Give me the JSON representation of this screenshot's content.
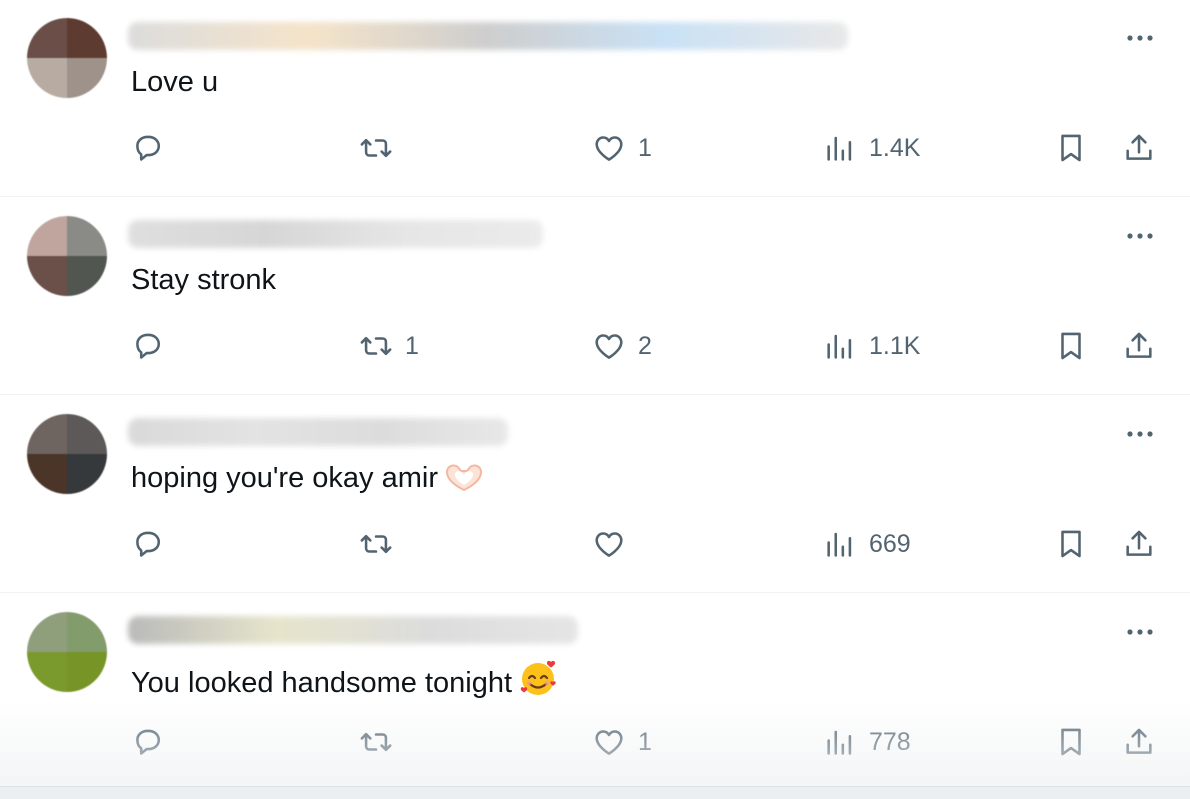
{
  "replies": [
    {
      "text": "Love u",
      "emoji": "",
      "avatar_colors": [
        "#6b4e48",
        "#5e3b30",
        "#b7aba2",
        "#9f928a"
      ],
      "name_blur_colors": [
        "#d9d9d9",
        "#f4e1c4",
        "#c9c9c9",
        "#c4dff5",
        "#e6e6e6"
      ],
      "name_blur_width": 720,
      "reply_count": "",
      "retweet_count": "",
      "like_count": "1",
      "views_count": "1.4K"
    },
    {
      "text": "Stay stronk",
      "emoji": "",
      "avatar_colors": [
        "#c0a59f",
        "#8a8a86",
        "#6a5048",
        "#525650"
      ],
      "name_blur_colors": [
        "#dcdcdc",
        "#d2d2d2",
        "#e4e4e4",
        "#e9e9e9"
      ],
      "name_blur_width": 415,
      "reply_count": "",
      "retweet_count": "1",
      "like_count": "2",
      "views_count": "1.1K"
    },
    {
      "text": "hoping you're okay amir",
      "emoji": "heart-hands",
      "avatar_colors": [
        "#6e6460",
        "#5d5958",
        "#4b3428",
        "#35393b"
      ],
      "name_blur_colors": [
        "#d6d6d6",
        "#e0e0e0",
        "#d9d9d9",
        "#e6e6e6"
      ],
      "name_blur_width": 380,
      "reply_count": "",
      "retweet_count": "",
      "like_count": "",
      "views_count": "669"
    },
    {
      "text": "You looked handsome tonight",
      "emoji": "smiling-face-with-hearts",
      "avatar_colors": [
        "#8f9f7c",
        "#829c6c",
        "#7b9a2e",
        "#769526"
      ],
      "name_blur_colors": [
        "#b3b3b3",
        "#e4e2c6",
        "#d9d9d9",
        "#e3e3e3"
      ],
      "name_blur_width": 450,
      "reply_count": "",
      "retweet_count": "",
      "like_count": "1",
      "views_count": "778"
    }
  ],
  "icons": {
    "reply": "reply-icon",
    "retweet": "retweet-icon",
    "like": "heart-icon",
    "views": "views-chart-icon",
    "bookmark": "bookmark-icon",
    "share": "share-icon",
    "more": "more-dots-icon"
  },
  "colors": {
    "text": "#0f1419",
    "secondary": "#536471",
    "divider": "#eff3f4"
  }
}
